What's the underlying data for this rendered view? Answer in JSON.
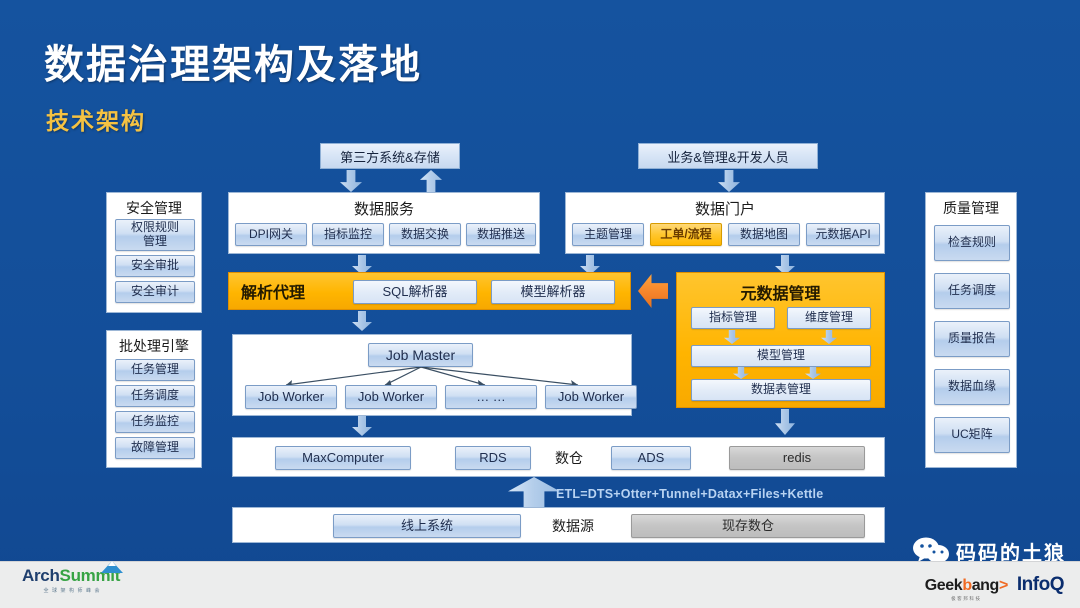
{
  "slide": {
    "title": "数据治理架构及落地",
    "subtitle": "技术架构",
    "accent_orange": "#ffb500",
    "background_blue": "#14539f",
    "subtitle_color": "#f5c242"
  },
  "callouts": {
    "third_party": "第三方系统&存储",
    "stakeholders": "业务&管理&开发人员"
  },
  "data_service": {
    "title": "数据服务",
    "items": [
      "DPI网关",
      "指标监控",
      "数据交换",
      "数据推送"
    ]
  },
  "data_portal": {
    "title": "数据门户",
    "items": [
      {
        "label": "主题管理",
        "highlight": false
      },
      {
        "label": "工单/流程",
        "highlight": true
      },
      {
        "label": "数据地图",
        "highlight": false
      },
      {
        "label": "元数据API",
        "highlight": false
      }
    ]
  },
  "parser_agent": {
    "title": "解析代理",
    "items": [
      "SQL解析器",
      "模型解析器"
    ]
  },
  "metadata_mgmt": {
    "title": "元数据管理",
    "items": [
      "指标管理",
      "维度管理",
      "模型管理",
      "数据表管理"
    ]
  },
  "job_engine": {
    "master": "Job Master",
    "workers": [
      "Job Worker",
      "Job Worker",
      "… …",
      "Job Worker"
    ]
  },
  "warehouse": {
    "label": "数仓",
    "items": [
      {
        "label": "MaxComputer",
        "gray": false
      },
      {
        "label": "RDS",
        "gray": false
      },
      {
        "label": "ADS",
        "gray": false
      },
      {
        "label": "redis",
        "gray": true
      }
    ]
  },
  "datasource": {
    "label": "数据源",
    "items": [
      {
        "label": "线上系统",
        "gray": false
      },
      {
        "label": "现存数仓",
        "gray": true
      }
    ]
  },
  "etl": {
    "text": "ETL=DTS+Otter+Tunnel+Datax+Files+Kettle"
  },
  "left_panels": [
    {
      "title": "安全管理",
      "items": [
        "权限规则\n管理",
        "安全审批",
        "安全审计"
      ]
    },
    {
      "title": "批处理引擎",
      "items": [
        "任务管理",
        "任务调度",
        "任务监控",
        "故障管理"
      ]
    }
  ],
  "right_panels": [
    {
      "title": "质量管理",
      "items": [
        "检查规则",
        "任务调度",
        "质量报告",
        "数据血缘",
        "UC矩阵"
      ]
    }
  ],
  "footer": {
    "arch_summit": "ArchSummit",
    "arch_summit_sub": "全球架构师峰会",
    "wechat_name": "码码的土狼",
    "geekbang": "Geekbang",
    "geekbang_sub": "极客邦科技",
    "infoq": "InfoQ"
  }
}
